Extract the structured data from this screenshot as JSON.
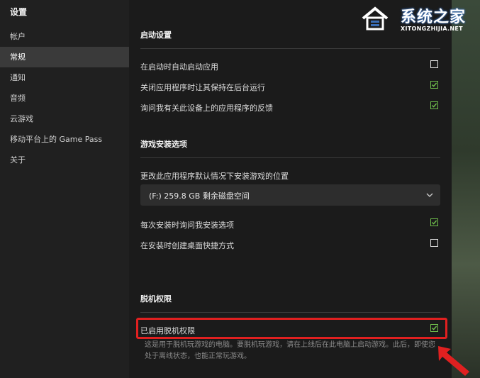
{
  "sidebar": {
    "title": "设置",
    "items": [
      {
        "label": "帐户"
      },
      {
        "label": "常规"
      },
      {
        "label": "通知"
      },
      {
        "label": "音频"
      },
      {
        "label": "云游戏"
      },
      {
        "label": "移动平台上的 Game Pass"
      },
      {
        "label": "关于"
      }
    ],
    "active_index": 1
  },
  "startup": {
    "title": "启动设置",
    "options": [
      {
        "label": "在启动时自动启动应用",
        "checked": false
      },
      {
        "label": "关闭应用程序时让其保持在后台运行",
        "checked": true
      },
      {
        "label": "询问我有关此设备上的应用程序的反馈",
        "checked": true
      }
    ]
  },
  "install": {
    "title": "游戏安装选项",
    "location_label": "更改此应用程序默认情况下安装游戏的位置",
    "location_value": "(F:) 259.8 GB 剩余磁盘空间",
    "options": [
      {
        "label": "每次安装时询问我安装选项",
        "checked": true
      },
      {
        "label": "在安装时创建桌面快捷方式",
        "checked": false
      }
    ]
  },
  "offline": {
    "title": "脱机权限",
    "option_label": "已启用脱机权限",
    "option_checked": true,
    "description": "这是用于脱机玩游戏的电脑。要脱机玩游戏，请在上线后在此电脑上启动游戏。此后，即使您处于离线状态，也能正常玩游戏。"
  },
  "watermark": {
    "name": "系统之家",
    "url": "XITONGZHIJIA.NET"
  },
  "colors": {
    "check_green": "#6fbf4b",
    "highlight_red": "#e02020",
    "active_nav_bg": "#3a3a3a"
  }
}
